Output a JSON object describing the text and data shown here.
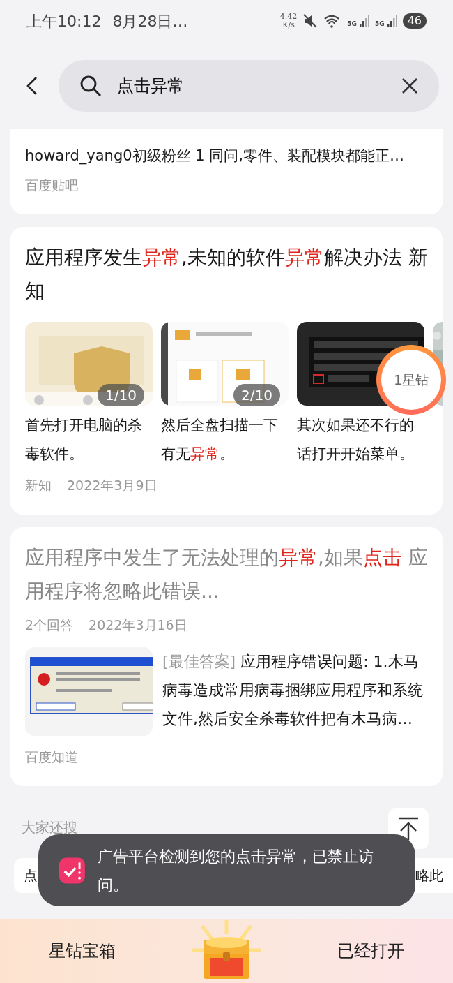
{
  "status_bar": {
    "time": "上午10:12",
    "date": "8月28日…",
    "net_speed": "4.42",
    "net_unit": "K/s",
    "network_1": "5G",
    "network_2": "5G",
    "battery": "46"
  },
  "search": {
    "value": "点击异常"
  },
  "results": [
    {
      "kind": "text",
      "lines": [
        "howard_yang0初级粉丝 1 同问,零件、装配模块都能正…"
      ],
      "source": "百度贴吧"
    },
    {
      "kind": "gallery",
      "visited": false,
      "title": [
        {
          "text": "应用程序发生",
          "highlight": false
        },
        {
          "text": "异常",
          "highlight": true
        },
        {
          "text": ",未知的软件",
          "highlight": false
        },
        {
          "text": "异常",
          "highlight": true
        },
        {
          "text": "解决办法 新知",
          "highlight": false
        }
      ],
      "images": [
        {
          "kind": "picture",
          "counter": "1/10",
          "caption": [
            {
              "text": "首先打开电脑的杀毒软件。",
              "highlight": false
            }
          ]
        },
        {
          "kind": "picture",
          "counter": "2/10",
          "caption": [
            {
              "text": "然后全盘扫描一下有无",
              "highlight": false
            },
            {
              "text": "异常",
              "highlight": true
            },
            {
              "text": "。",
              "highlight": false
            }
          ]
        },
        {
          "kind": "picture",
          "caption": [
            {
              "text": "其次如果还不行的话打开开始菜单。",
              "highlight": false
            }
          ]
        },
        {
          "kind": "picture"
        }
      ],
      "source": "新知",
      "date": "2022年3月9日"
    },
    {
      "kind": "answer",
      "visited": true,
      "title": [
        {
          "text": "应用程序中发生了无法处理的",
          "highlight": false
        },
        {
          "text": "异常",
          "highlight": true
        },
        {
          "text": ",如果",
          "highlight": false
        },
        {
          "text": "点击",
          "highlight": true
        },
        {
          "text": " 应用程序将忽略此错误...",
          "highlight": false
        }
      ],
      "answers": "2个回答",
      "date": "2022年3月16日",
      "answer_tag": "[最佳答案]",
      "answer": "应用程序错误问题: 1.木马病毒造成常用病毒捆绑应用程序和系统文件,然后安全杀毒软件把有木马病…",
      "source": "百度知道"
    }
  ],
  "related": {
    "title": "大家还搜",
    "chips": [
      "点",
      "略此"
    ]
  },
  "toast": {
    "text": "广告平台检测到您的点击异常，已禁止访问。"
  },
  "reward_badge": "1星钻",
  "banner": {
    "label": "星钻宝箱",
    "status": "已经打开"
  }
}
